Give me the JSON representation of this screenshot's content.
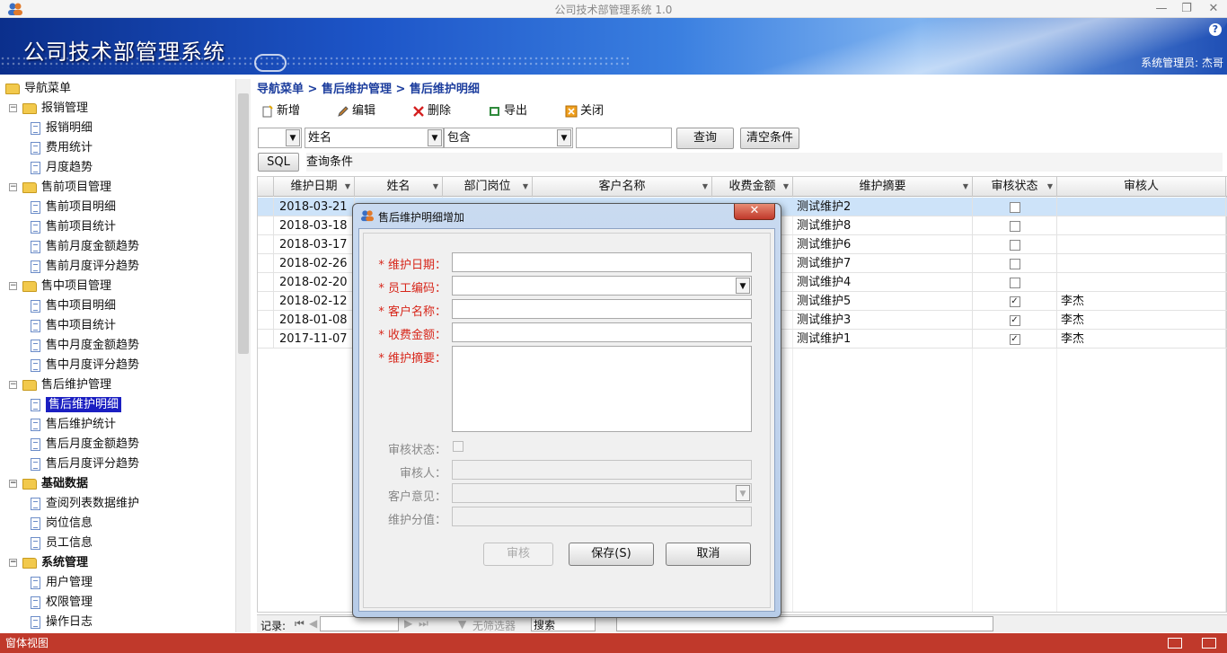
{
  "window": {
    "title": "公司技术部管理系统 1.0",
    "minimize": "—",
    "restore": "❐",
    "close": "✕"
  },
  "banner": {
    "app_name": "公司技术部管理系统",
    "help": "?",
    "user": "系统管理员: 杰哥"
  },
  "sidebar": {
    "items": [
      {
        "label": "导航菜单",
        "level": 0,
        "type": "folder",
        "bold": false
      },
      {
        "label": "报销管理",
        "level": 1,
        "type": "folder",
        "bold": false
      },
      {
        "label": "报销明细",
        "level": 2,
        "type": "doc"
      },
      {
        "label": "费用统计",
        "level": 2,
        "type": "doc"
      },
      {
        "label": "月度趋势",
        "level": 2,
        "type": "doc"
      },
      {
        "label": "售前项目管理",
        "level": 1,
        "type": "folder"
      },
      {
        "label": "售前项目明细",
        "level": 2,
        "type": "doc"
      },
      {
        "label": "售前项目统计",
        "level": 2,
        "type": "doc"
      },
      {
        "label": "售前月度金额趋势",
        "level": 2,
        "type": "doc"
      },
      {
        "label": "售前月度评分趋势",
        "level": 2,
        "type": "doc"
      },
      {
        "label": "售中项目管理",
        "level": 1,
        "type": "folder"
      },
      {
        "label": "售中项目明细",
        "level": 2,
        "type": "doc"
      },
      {
        "label": "售中项目统计",
        "level": 2,
        "type": "doc"
      },
      {
        "label": "售中月度金额趋势",
        "level": 2,
        "type": "doc"
      },
      {
        "label": "售中月度评分趋势",
        "level": 2,
        "type": "doc"
      },
      {
        "label": "售后维护管理",
        "level": 1,
        "type": "folder"
      },
      {
        "label": "售后维护明细",
        "level": 2,
        "type": "doc",
        "selected": true
      },
      {
        "label": "售后维护统计",
        "level": 2,
        "type": "doc"
      },
      {
        "label": "售后月度金额趋势",
        "level": 2,
        "type": "doc"
      },
      {
        "label": "售后月度评分趋势",
        "level": 2,
        "type": "doc"
      },
      {
        "label": "基础数据",
        "level": 1,
        "type": "folder",
        "bold": true
      },
      {
        "label": "查阅列表数据维护",
        "level": 2,
        "type": "doc"
      },
      {
        "label": "岗位信息",
        "level": 2,
        "type": "doc"
      },
      {
        "label": "员工信息",
        "level": 2,
        "type": "doc"
      },
      {
        "label": "系统管理",
        "level": 1,
        "type": "folder",
        "bold": true
      },
      {
        "label": "用户管理",
        "level": 2,
        "type": "doc"
      },
      {
        "label": "权限管理",
        "level": 2,
        "type": "doc"
      },
      {
        "label": "操作日志",
        "level": 2,
        "type": "doc"
      }
    ]
  },
  "breadcrumb": "导航菜单 > 售后维护管理 > 售后维护明细",
  "toolbar": {
    "add": "新增",
    "edit": "编辑",
    "delete": "删除",
    "export": "导出",
    "close": "关闭"
  },
  "filter": {
    "field": "姓名",
    "op": "包含",
    "value": "",
    "query": "查询",
    "clear": "清空条件",
    "sql": "SQL",
    "condition": "查询条件"
  },
  "grid": {
    "columns": [
      "维护日期",
      "姓名",
      "部门岗位",
      "客户名称",
      "收费金额",
      "维护摘要",
      "审核状态",
      "审核人"
    ],
    "rows": [
      {
        "date": "2018-03-21",
        "summary": "测试维护2",
        "checked": false,
        "auditor": ""
      },
      {
        "date": "2018-03-18",
        "summary": "测试维护8",
        "checked": false,
        "auditor": ""
      },
      {
        "date": "2018-03-17",
        "summary": "测试维护6",
        "checked": false,
        "auditor": ""
      },
      {
        "date": "2018-02-26",
        "summary": "测试维护7",
        "checked": false,
        "auditor": ""
      },
      {
        "date": "2018-02-20",
        "summary": "测试维护4",
        "checked": false,
        "auditor": ""
      },
      {
        "date": "2018-02-12",
        "summary": "测试维护5",
        "checked": true,
        "auditor": "李杰"
      },
      {
        "date": "2018-01-08",
        "summary": "测试维护3",
        "checked": true,
        "auditor": "李杰"
      },
      {
        "date": "2017-11-07",
        "summary": "测试维护1",
        "checked": true,
        "auditor": "李杰"
      }
    ],
    "check_mark": "✓"
  },
  "statusbar": {
    "records": "记录:",
    "no_filter": "无筛选器",
    "search": "搜索"
  },
  "bottombar": {
    "label": "窗体视图"
  },
  "dialog": {
    "title": "售后维护明细增加",
    "close": "✕",
    "fields": {
      "date": "* 维护日期：",
      "emp": "* 员工编码：",
      "customer": "* 客户名称：",
      "amount": "* 收费金额：",
      "summary": "* 维护摘要：",
      "audit_status": "审核状态：",
      "auditor": "审核人：",
      "opinion": "客户意见：",
      "score": "维护分值："
    },
    "buttons": {
      "audit": "审核",
      "save": "保存(S)",
      "cancel": "取消"
    }
  },
  "colors": {
    "accent": "#1d3e9e",
    "selected": "#1b1fc2",
    "bottombar": "#c0392b",
    "required": "#d7261a"
  }
}
